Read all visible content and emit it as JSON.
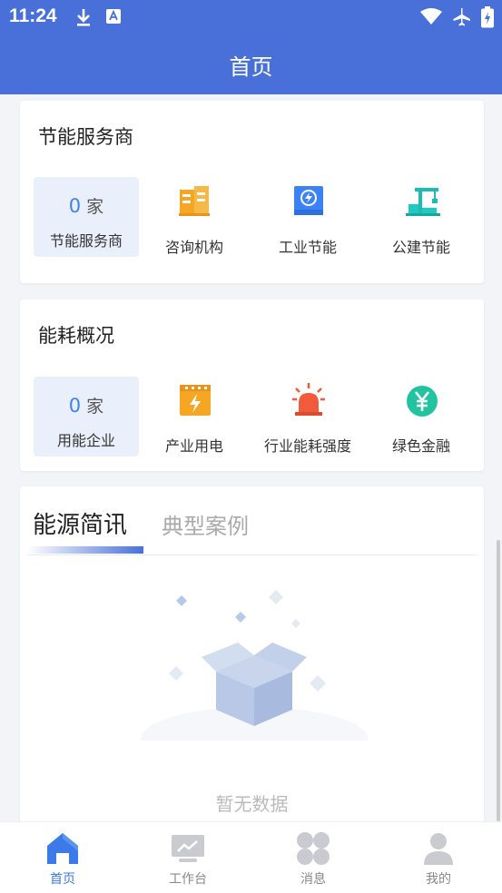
{
  "status_bar": {
    "time": "11:24"
  },
  "header": {
    "title": "首页"
  },
  "energy_service": {
    "title": "节能服务商",
    "stat": {
      "value": "0",
      "unit": "家",
      "label": "节能服务商"
    },
    "items": [
      {
        "label": "咨询机构",
        "icon": "consulting-building-icon"
      },
      {
        "label": "工业节能",
        "icon": "industrial-energy-icon"
      },
      {
        "label": "公建节能",
        "icon": "public-building-crane-icon"
      }
    ]
  },
  "energy_overview": {
    "title": "能耗概况",
    "stat": {
      "value": "0",
      "unit": "家",
      "label": "用能企业"
    },
    "items": [
      {
        "label": "产业用电",
        "icon": "power-icon"
      },
      {
        "label": "行业能耗强度",
        "icon": "alarm-light-icon"
      },
      {
        "label": "绿色金融",
        "icon": "yuan-icon"
      }
    ]
  },
  "news": {
    "tabs": [
      "能源简讯",
      "典型案例"
    ],
    "active_tab": 0,
    "empty_text": "暂无数据"
  },
  "bottom_nav": [
    {
      "label": "首页",
      "active": true
    },
    {
      "label": "工作台",
      "active": false
    },
    {
      "label": "消息",
      "active": false
    },
    {
      "label": "我的",
      "active": false
    }
  ],
  "colors": {
    "primary": "#4870d8",
    "accent_blue": "#3b82f6",
    "orange": "#f5a623",
    "teal": "#1bbcb4",
    "red": "#f25a3c",
    "green": "#22c3a0"
  }
}
